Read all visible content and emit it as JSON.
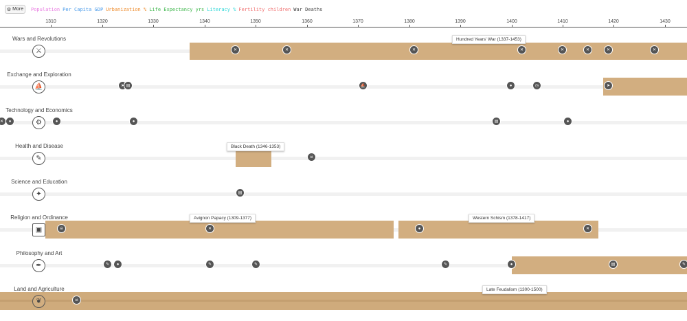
{
  "toolbar": {
    "more_label": "More",
    "metrics": [
      {
        "label": "Population",
        "color": "#e87ae0"
      },
      {
        "label": "Per Capita GDP",
        "color": "#4a9bea"
      },
      {
        "label": "Urbanization %",
        "color": "#ee8a2a"
      },
      {
        "label": "Life Expectancy yrs",
        "color": "#3cb64a"
      },
      {
        "label": "Literacy %",
        "color": "#2bd7d7"
      },
      {
        "label": "Fertility children",
        "color": "#f06d6d"
      },
      {
        "label": "War Deaths",
        "color": "#444444"
      }
    ]
  },
  "axis": {
    "years": [
      "1310",
      "1320",
      "1330",
      "1340",
      "1350",
      "1360",
      "1370",
      "1380",
      "1390",
      "1400",
      "1410",
      "1420",
      "1430"
    ]
  },
  "rows": [
    {
      "label": "Wars and Revolutions",
      "icon": "crossed-swords-icon"
    },
    {
      "label": "Exchange and Exploration",
      "icon": "ship-icon"
    },
    {
      "label": "Technology and Economics",
      "icon": "gears-icon"
    },
    {
      "label": "Health and Disease",
      "icon": "syringe-icon"
    },
    {
      "label": "Science and Education",
      "icon": "telescope-icon"
    },
    {
      "label": "Religion and Ordinance",
      "icon": "book-icon"
    },
    {
      "label": "Philosophy and Art",
      "icon": "quill-icon"
    },
    {
      "label": "Land and Agriculture",
      "icon": "wheat-icon"
    }
  ],
  "periods": [
    {
      "label": "Hundred Years' War (1337-1453)"
    },
    {
      "label": "Black Death (1346-1353)"
    },
    {
      "label": "Avignon Papacy (1309-1377)"
    },
    {
      "label": "Western Schism (1378-1417)"
    },
    {
      "label": "Late Feudalism (1300-1500)"
    }
  ],
  "event_icons": {
    "war": "crossed-swords",
    "explore": "compass",
    "idea": "lightbulb",
    "building": "institution",
    "skull": "skull",
    "quill": "quill",
    "ship": "ship",
    "clock": "clock"
  }
}
